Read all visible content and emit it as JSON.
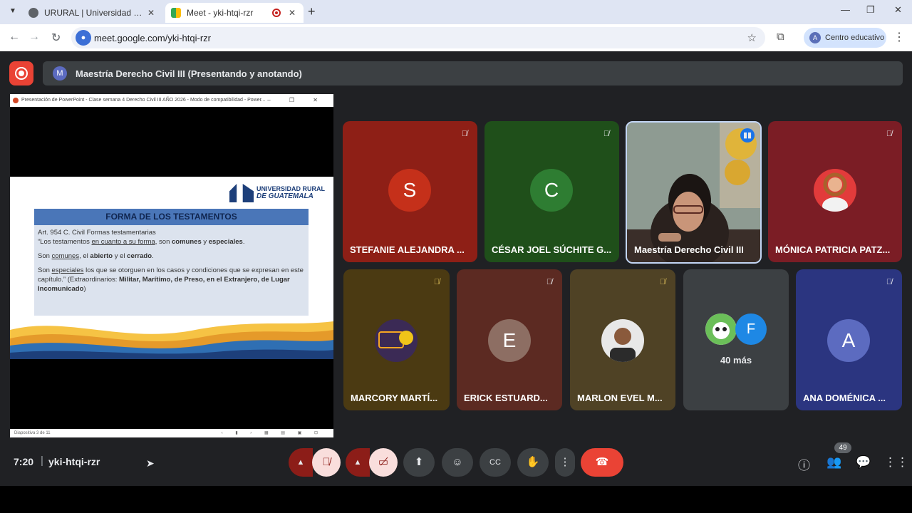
{
  "browser": {
    "tabs": [
      {
        "title": "URURAL | Universidad Rural de",
        "active": false
      },
      {
        "title": "Meet - yki-htqi-rzr",
        "active": true
      }
    ],
    "url": "meet.google.com/yki-htqi-rzr",
    "profile": {
      "initial": "A",
      "label": "Centro educativo"
    }
  },
  "meet": {
    "presenting_banner": {
      "initial": "M",
      "text": "Maestría Derecho Civil III (Presentando y anotando)"
    },
    "shared_window_title": "Presentación de PowerPoint - Clase semana 4 Derecho Civil III AÑO 2026 - Modo de compatibilidad - Power...",
    "slide": {
      "logo_line1": "UNIVERSIDAD RURAL",
      "logo_line2": "DE GUATEMALA",
      "heading": "FORMA DE LOS TESTAMENTOS",
      "p1_line1": "Art. 954 C. Civil Formas testamentarias",
      "p1_a": "“Los testamentos ",
      "p1_u": "en cuanto a su forma",
      "p1_b": ", son ",
      "p1_c": "comunes",
      "p1_d": " y ",
      "p1_e": "especiales",
      "p1_f": ".",
      "p2_a": "Son ",
      "p2_u": "comunes",
      "p2_b": ", el ",
      "p2_c": "abierto",
      "p2_d": " y el ",
      "p2_e": "cerrado",
      "p2_f": ".",
      "p3_a": "Son ",
      "p3_u": "especiales",
      "p3_b": " los que se otorguen en los casos y condiciones que se expresan en este capítulo.” (Extraordinarios: ",
      "p3_c": "Militar, Marítimo, de Preso, en el Extranjero, de Lugar Incomunicado",
      "p3_d": ")",
      "status": "Diapositiva 3 de 11"
    },
    "participants_row1": [
      {
        "name": "STEFANIE ALEJANDRA ...",
        "initial": "S",
        "avatar_color": "#c5301a",
        "tile_color": "#8e1f16",
        "muted": true
      },
      {
        "name": "CÉSAR JOEL SÚCHITE G...",
        "initial": "C",
        "avatar_color": "#2e7d32",
        "tile_color": "#1f4f1a",
        "muted": true
      },
      {
        "name": "Maestría Derecho Civil III",
        "speaking": true
      },
      {
        "name": "MÓNICA PATRICIA PATZ...",
        "muted": true
      }
    ],
    "participants_row2": [
      {
        "name": "MARCORY MARTÍ...",
        "muted": true
      },
      {
        "name": "ERICK ESTUARD...",
        "initial": "E",
        "avatar_color": "#8d6e63",
        "muted": true
      },
      {
        "name": "MARLON EVEL M...",
        "muted": true
      },
      {
        "others_initial": "F",
        "more_label": "40 más"
      },
      {
        "name": "ANA DOMÉNICA ...",
        "initial": "A",
        "avatar_color": "#5c6bc0",
        "muted": true
      }
    ],
    "bottom": {
      "time": "7:20",
      "meeting_code": "yki-htqi-rzr",
      "participant_count": "49"
    }
  }
}
